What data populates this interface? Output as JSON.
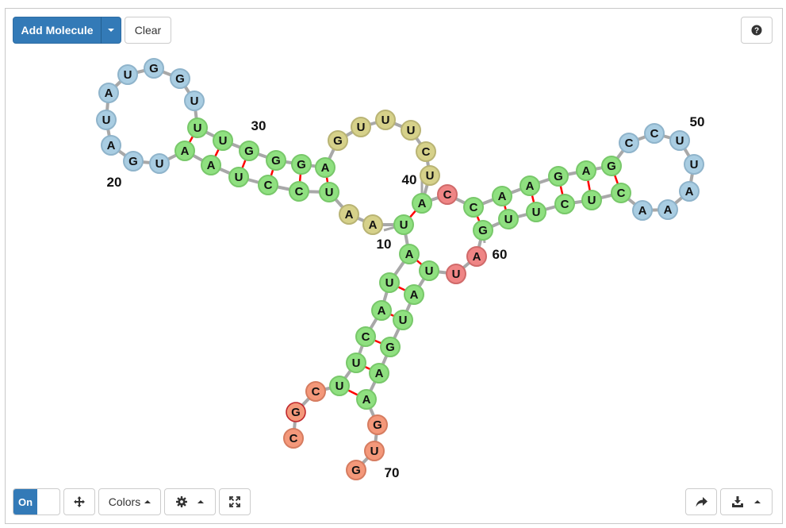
{
  "toolbar": {
    "add_molecule_label": "Add Molecule",
    "clear_label": "Clear",
    "colors_label": "Colors",
    "toggle_on_label": "On"
  },
  "icons": {
    "add_molecule_dropdown": "caret-down-icon",
    "help": "question-circle-icon",
    "pan": "move-arrows-icon",
    "colors_dropdown": "caret-up-icon",
    "settings": "gear-icon",
    "settings_dropdown": "caret-up-icon",
    "fullscreen": "expand-icon",
    "share": "share-arrow-icon",
    "download": "download-icon",
    "download_dropdown": "caret-up-icon"
  },
  "colors": {
    "primary_button": "#337ab7",
    "backbone": "#a8a8a8",
    "base_pair_bond": "#ff0000",
    "highlight_ring": "#c0282d",
    "region_blue": "#a9cde2",
    "region_yellow": "#d6d18a",
    "region_green": "#8fe080",
    "region_pink": "#ef8585",
    "region_orange": "#f4987a"
  },
  "molecule": {
    "nucleotides": [
      {
        "index": 1,
        "base": "C",
        "region": "orange"
      },
      {
        "index": 2,
        "base": "G",
        "region": "orange",
        "highlighted": true
      },
      {
        "index": 3,
        "base": "C",
        "region": "orange"
      },
      {
        "index": 4,
        "base": "U",
        "region": "green"
      },
      {
        "index": 5,
        "base": "U",
        "region": "green"
      },
      {
        "index": 6,
        "base": "C",
        "region": "green"
      },
      {
        "index": 7,
        "base": "A",
        "region": "green"
      },
      {
        "index": 8,
        "base": "U",
        "region": "green"
      },
      {
        "index": 9,
        "base": "A",
        "region": "green"
      },
      {
        "index": 10,
        "base": "U",
        "region": "green"
      },
      {
        "index": 11,
        "base": "A",
        "region": "yellow"
      },
      {
        "index": 12,
        "base": "A",
        "region": "yellow"
      },
      {
        "index": 13,
        "base": "U",
        "region": "green"
      },
      {
        "index": 14,
        "base": "C",
        "region": "green"
      },
      {
        "index": 15,
        "base": "C",
        "region": "green"
      },
      {
        "index": 16,
        "base": "U",
        "region": "green"
      },
      {
        "index": 17,
        "base": "A",
        "region": "green"
      },
      {
        "index": 18,
        "base": "A",
        "region": "green"
      },
      {
        "index": 19,
        "base": "U",
        "region": "blue"
      },
      {
        "index": 20,
        "base": "G",
        "region": "blue"
      },
      {
        "index": 21,
        "base": "A",
        "region": "blue"
      },
      {
        "index": 22,
        "base": "U",
        "region": "blue"
      },
      {
        "index": 23,
        "base": "A",
        "region": "blue"
      },
      {
        "index": 24,
        "base": "U",
        "region": "blue"
      },
      {
        "index": 25,
        "base": "G",
        "region": "blue"
      },
      {
        "index": 26,
        "base": "G",
        "region": "blue"
      },
      {
        "index": 27,
        "base": "U",
        "region": "blue"
      },
      {
        "index": 28,
        "base": "U",
        "region": "green"
      },
      {
        "index": 29,
        "base": "U",
        "region": "green"
      },
      {
        "index": 30,
        "base": "G",
        "region": "green"
      },
      {
        "index": 31,
        "base": "G",
        "region": "green"
      },
      {
        "index": 32,
        "base": "G",
        "region": "green"
      },
      {
        "index": 33,
        "base": "A",
        "region": "green"
      },
      {
        "index": 34,
        "base": "G",
        "region": "yellow"
      },
      {
        "index": 35,
        "base": "U",
        "region": "yellow"
      },
      {
        "index": 36,
        "base": "U",
        "region": "yellow"
      },
      {
        "index": 37,
        "base": "U",
        "region": "yellow"
      },
      {
        "index": 38,
        "base": "C",
        "region": "yellow"
      },
      {
        "index": 39,
        "base": "U",
        "region": "yellow"
      },
      {
        "index": 40,
        "base": "A",
        "region": "green"
      },
      {
        "index": 41,
        "base": "C",
        "region": "pink"
      },
      {
        "index": 42,
        "base": "C",
        "region": "green"
      },
      {
        "index": 43,
        "base": "A",
        "region": "green"
      },
      {
        "index": 44,
        "base": "A",
        "region": "green"
      },
      {
        "index": 45,
        "base": "G",
        "region": "green"
      },
      {
        "index": 46,
        "base": "A",
        "region": "green"
      },
      {
        "index": 47,
        "base": "G",
        "region": "green"
      },
      {
        "index": 48,
        "base": "C",
        "region": "blue"
      },
      {
        "index": 49,
        "base": "C",
        "region": "blue"
      },
      {
        "index": 50,
        "base": "U",
        "region": "blue"
      },
      {
        "index": 51,
        "base": "U",
        "region": "blue"
      },
      {
        "index": 52,
        "base": "A",
        "region": "blue"
      },
      {
        "index": 53,
        "base": "A",
        "region": "blue"
      },
      {
        "index": 54,
        "base": "A",
        "region": "blue"
      },
      {
        "index": 55,
        "base": "C",
        "region": "green"
      },
      {
        "index": 56,
        "base": "U",
        "region": "green"
      },
      {
        "index": 57,
        "base": "C",
        "region": "green"
      },
      {
        "index": 58,
        "base": "U",
        "region": "green"
      },
      {
        "index": 59,
        "base": "U",
        "region": "green"
      },
      {
        "index": 60,
        "base": "G",
        "region": "green"
      },
      {
        "index": 61,
        "base": "A",
        "region": "pink"
      },
      {
        "index": 62,
        "base": "U",
        "region": "pink"
      },
      {
        "index": 63,
        "base": "U",
        "region": "green"
      },
      {
        "index": 64,
        "base": "A",
        "region": "green"
      },
      {
        "index": 65,
        "base": "U",
        "region": "green"
      },
      {
        "index": 66,
        "base": "G",
        "region": "green"
      },
      {
        "index": 67,
        "base": "A",
        "region": "green"
      },
      {
        "index": 68,
        "base": "A",
        "region": "green"
      },
      {
        "index": 69,
        "base": "G",
        "region": "orange"
      },
      {
        "index": 70,
        "base": "U",
        "region": "orange"
      },
      {
        "index": 71,
        "base": "G",
        "region": "orange"
      }
    ],
    "pairs": [
      [
        4,
        68
      ],
      [
        5,
        67
      ],
      [
        6,
        66
      ],
      [
        7,
        65
      ],
      [
        8,
        64
      ],
      [
        9,
        63
      ],
      [
        10,
        40
      ],
      [
        13,
        33
      ],
      [
        14,
        32
      ],
      [
        15,
        31
      ],
      [
        16,
        30
      ],
      [
        17,
        29
      ],
      [
        18,
        28
      ],
      [
        42,
        60
      ],
      [
        43,
        59
      ],
      [
        44,
        58
      ],
      [
        45,
        57
      ],
      [
        46,
        56
      ],
      [
        47,
        55
      ]
    ],
    "index_labels": [
      "10",
      "20",
      "30",
      "40",
      "50",
      "60",
      "70"
    ]
  }
}
